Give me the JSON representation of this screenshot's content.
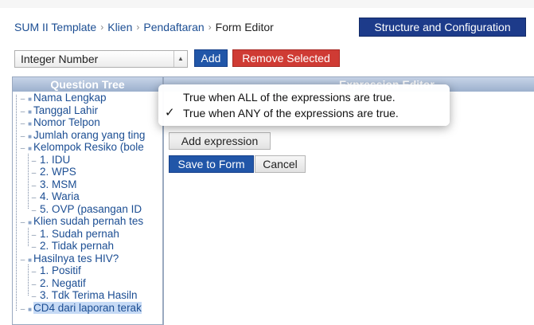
{
  "breadcrumb": {
    "items": [
      "SUM II Template",
      "Klien",
      "Pendaftaran"
    ],
    "current": "Form Editor",
    "separator": "›"
  },
  "header": {
    "structure_button": "Structure and Configuration"
  },
  "toolbar": {
    "type_select_value": "Integer Number",
    "add_label": "Add",
    "remove_label": "Remove Selected"
  },
  "question_tree": {
    "title": "Question Tree",
    "items": [
      {
        "label": "Nama Lengkap",
        "level": 0,
        "icon": "question-icon"
      },
      {
        "label": "Tanggal Lahir",
        "level": 0,
        "icon": "question-icon"
      },
      {
        "label": "Nomor Telpon",
        "level": 0,
        "icon": "question-icon"
      },
      {
        "label": "Jumlah orang yang ting",
        "level": 0,
        "icon": "question-icon"
      },
      {
        "label": "Kelompok Resiko (bole",
        "level": 0,
        "icon": "question-icon"
      },
      {
        "label": "1. IDU",
        "level": 1,
        "icon": "option-icon"
      },
      {
        "label": "2. WPS",
        "level": 1,
        "icon": "option-icon"
      },
      {
        "label": "3. MSM",
        "level": 1,
        "icon": "option-icon"
      },
      {
        "label": "4. Waria",
        "level": 1,
        "icon": "option-icon"
      },
      {
        "label": "5. OVP (pasangan ID",
        "level": 1,
        "icon": "option-icon"
      },
      {
        "label": "Klien sudah pernah tes",
        "level": 0,
        "icon": "question-icon"
      },
      {
        "label": "1. Sudah pernah",
        "level": 1,
        "icon": "option-icon"
      },
      {
        "label": "2. Tidak pernah",
        "level": 1,
        "icon": "option-icon"
      },
      {
        "label": "Hasilnya tes HIV?",
        "level": 0,
        "icon": "question-icon"
      },
      {
        "label": "1. Positif",
        "level": 1,
        "icon": "option-icon"
      },
      {
        "label": "2. Negatif",
        "level": 1,
        "icon": "option-icon"
      },
      {
        "label": "3. Tdk Terima Hasiln",
        "level": 1,
        "icon": "option-icon"
      },
      {
        "label": "CD4 dari laporan terak",
        "level": 0,
        "icon": "question-icon",
        "selected": true
      }
    ]
  },
  "expression_editor": {
    "title": "Expression Editor",
    "add_expression_label": "Add expression",
    "save_label": "Save to Form",
    "cancel_label": "Cancel"
  },
  "match_menu": {
    "items": [
      {
        "label": "True when ALL of the expressions are true.",
        "checked": false
      },
      {
        "label": "True when ANY of the expressions are true.",
        "checked": true
      }
    ],
    "check_glyph": "✓"
  },
  "colors": {
    "primary_button": "#2156a8",
    "danger_button": "#cf3b34",
    "nav_button": "#1d3b8a",
    "link": "#1c4e93",
    "selection": "#c6daf5"
  }
}
